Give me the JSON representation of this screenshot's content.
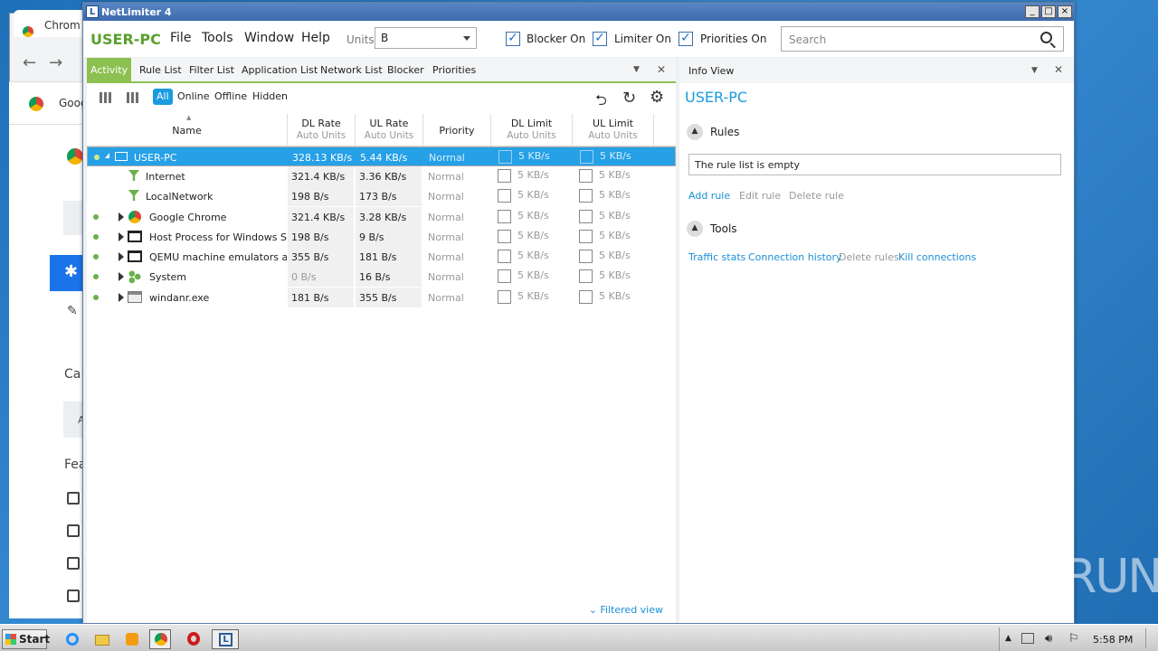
{
  "chrome_bg": {
    "tab_label": "Chrom",
    "bookmark_label": "Goog",
    "page_text_1": "Ca",
    "page_text_2": "Fea",
    "page_text_3": "A"
  },
  "window": {
    "title": "NetLimiter 4",
    "logo": "L",
    "min": "_",
    "max": "□",
    "close": "×"
  },
  "menubar": {
    "host": "USER-PC",
    "items": [
      "File",
      "Tools",
      "Window",
      "Help"
    ],
    "units_label": "Units",
    "units_value": "B",
    "blocker_label": "Blocker On",
    "limiter_label": "Limiter On",
    "priorities_label": "Priorities On",
    "check": "✓",
    "search_placeholder": "Search"
  },
  "tabs": [
    "Activity",
    "Rule List",
    "Filter List",
    "Application List",
    "Network List",
    "Blocker",
    "Priorities"
  ],
  "tab_controls": {
    "dropdown": "▼",
    "close": "✕"
  },
  "filters": {
    "all": "All",
    "online": "Online",
    "offline": "Offline",
    "hidden": "Hidden"
  },
  "toolbar_icons": {
    "back": "⮌",
    "refresh": "↻",
    "settings": "⚙"
  },
  "columns": {
    "sort_arrow": "▲",
    "name": "Name",
    "dl_rate": "DL Rate",
    "ul_rate": "UL Rate",
    "units_sub": "Auto Units",
    "priority": "Priority",
    "dl_limit": "DL Limit",
    "ul_limit": "UL Limit"
  },
  "rows": [
    {
      "name": "USER-PC",
      "dl": "328.13 KB/s",
      "ul": "5.44 KB/s",
      "priority": "Normal",
      "dl_limit": "5 KB/s",
      "ul_limit": "5 KB/s"
    },
    {
      "name": "Internet",
      "dl": "321.4 KB/s",
      "ul": "3.36 KB/s",
      "priority": "Normal",
      "dl_limit": "5 KB/s",
      "ul_limit": "5 KB/s"
    },
    {
      "name": "LocalNetwork",
      "dl": "198 B/s",
      "ul": "173 B/s",
      "priority": "Normal",
      "dl_limit": "5 KB/s",
      "ul_limit": "5 KB/s"
    },
    {
      "name": "Google Chrome",
      "dl": "321.4 KB/s",
      "ul": "3.28 KB/s",
      "priority": "Normal",
      "dl_limit": "5 KB/s",
      "ul_limit": "5 KB/s"
    },
    {
      "name": "Host Process for Windows Ser",
      "dl": "198 B/s",
      "ul": "9 B/s",
      "priority": "Normal",
      "dl_limit": "5 KB/s",
      "ul_limit": "5 KB/s"
    },
    {
      "name": "QEMU machine emulators and",
      "dl": "355 B/s",
      "ul": "181 B/s",
      "priority": "Normal",
      "dl_limit": "5 KB/s",
      "ul_limit": "5 KB/s"
    },
    {
      "name": "System",
      "dl": "0 B/s",
      "ul": "16 B/s",
      "priority": "Normal",
      "dl_limit": "5 KB/s",
      "ul_limit": "5 KB/s"
    },
    {
      "name": "windanr.exe",
      "dl": "181 B/s",
      "ul": "355 B/s",
      "priority": "Normal",
      "dl_limit": "5 KB/s",
      "ul_limit": "5 KB/s"
    }
  ],
  "filtered_view": "Filtered view",
  "filtered_chevron": "⌄",
  "info": {
    "title": "Info View",
    "host": "USER-PC",
    "rules_label": "Rules",
    "rules_empty": "The rule list is empty",
    "add_rule": "Add rule",
    "edit_rule": "Edit rule",
    "delete_rule": "Delete rule",
    "tools_label": "Tools",
    "traffic_stats": "Traffic stats",
    "connection_history": "Connection history",
    "delete_rules": "Delete rules",
    "kill_connections": "Kill connections",
    "collapse": "▲"
  },
  "taskbar": {
    "start": "Start",
    "clock": "5:58 PM",
    "tray_up": "▲",
    "icons": [
      "ie-icon",
      "explorer-icon",
      "media-icon",
      "chrome-icon",
      "opera-icon",
      "netlimiter-icon"
    ]
  },
  "watermark": "ANY▷RUN"
}
